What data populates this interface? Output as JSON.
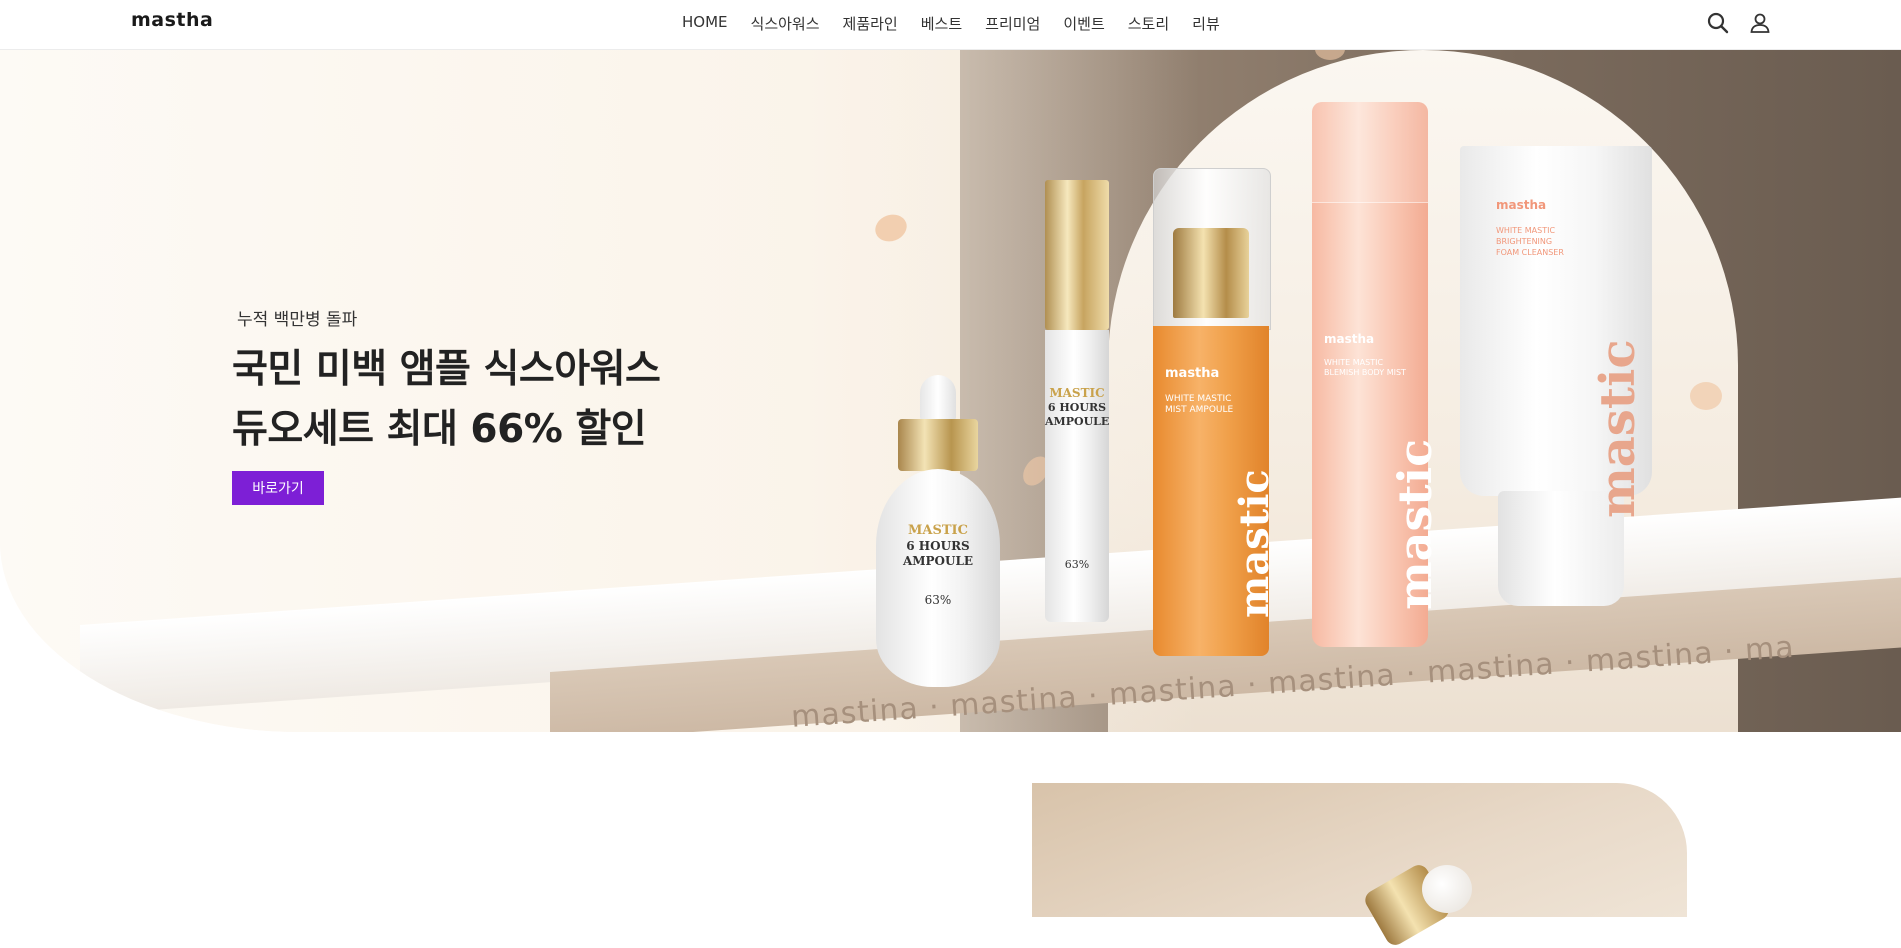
{
  "header": {
    "logo": "mastha",
    "nav": [
      "HOME",
      "식스아워스",
      "제품라인",
      "베스트",
      "프리미엄",
      "이벤트",
      "스토리",
      "리뷰"
    ],
    "icons": [
      "search-icon",
      "user-icon"
    ]
  },
  "hero": {
    "subtitle": "누적 백만병 돌파",
    "title_line1": "국민 미백 앰플 식스아워스",
    "title_line2": "듀오세트 최대 66% 할인",
    "cta": "바로가기",
    "accent_color": "#7d1fd6",
    "shelf_text": "mastina · mastina · mastina · mastina · mastina · mastina · ma",
    "products": {
      "dropper": {
        "brand": "MASTIC",
        "line1": "6 HOURS",
        "line2": "AMPOULE",
        "pct": "63%"
      },
      "tube": {
        "brand": "MASTIC",
        "line1": "6 HOURS",
        "line2": "AMPOULE",
        "pct": "63%"
      },
      "orange_bottle": {
        "brand": "mastha",
        "name1": "WHITE MASTIC",
        "name2": "MIST AMPOULE",
        "vertical": "mastic"
      },
      "pink_bottle": {
        "brand": "mastha",
        "name1": "WHITE MASTIC",
        "name2": "BLEMISH BODY MIST",
        "vertical": "mastic"
      },
      "cleanser": {
        "brand": "mastha",
        "name1": "WHITE MASTIC",
        "name2": "BRIGHTENING",
        "name3": "FOAM CLEANSER",
        "vertical": "mastic"
      }
    }
  }
}
